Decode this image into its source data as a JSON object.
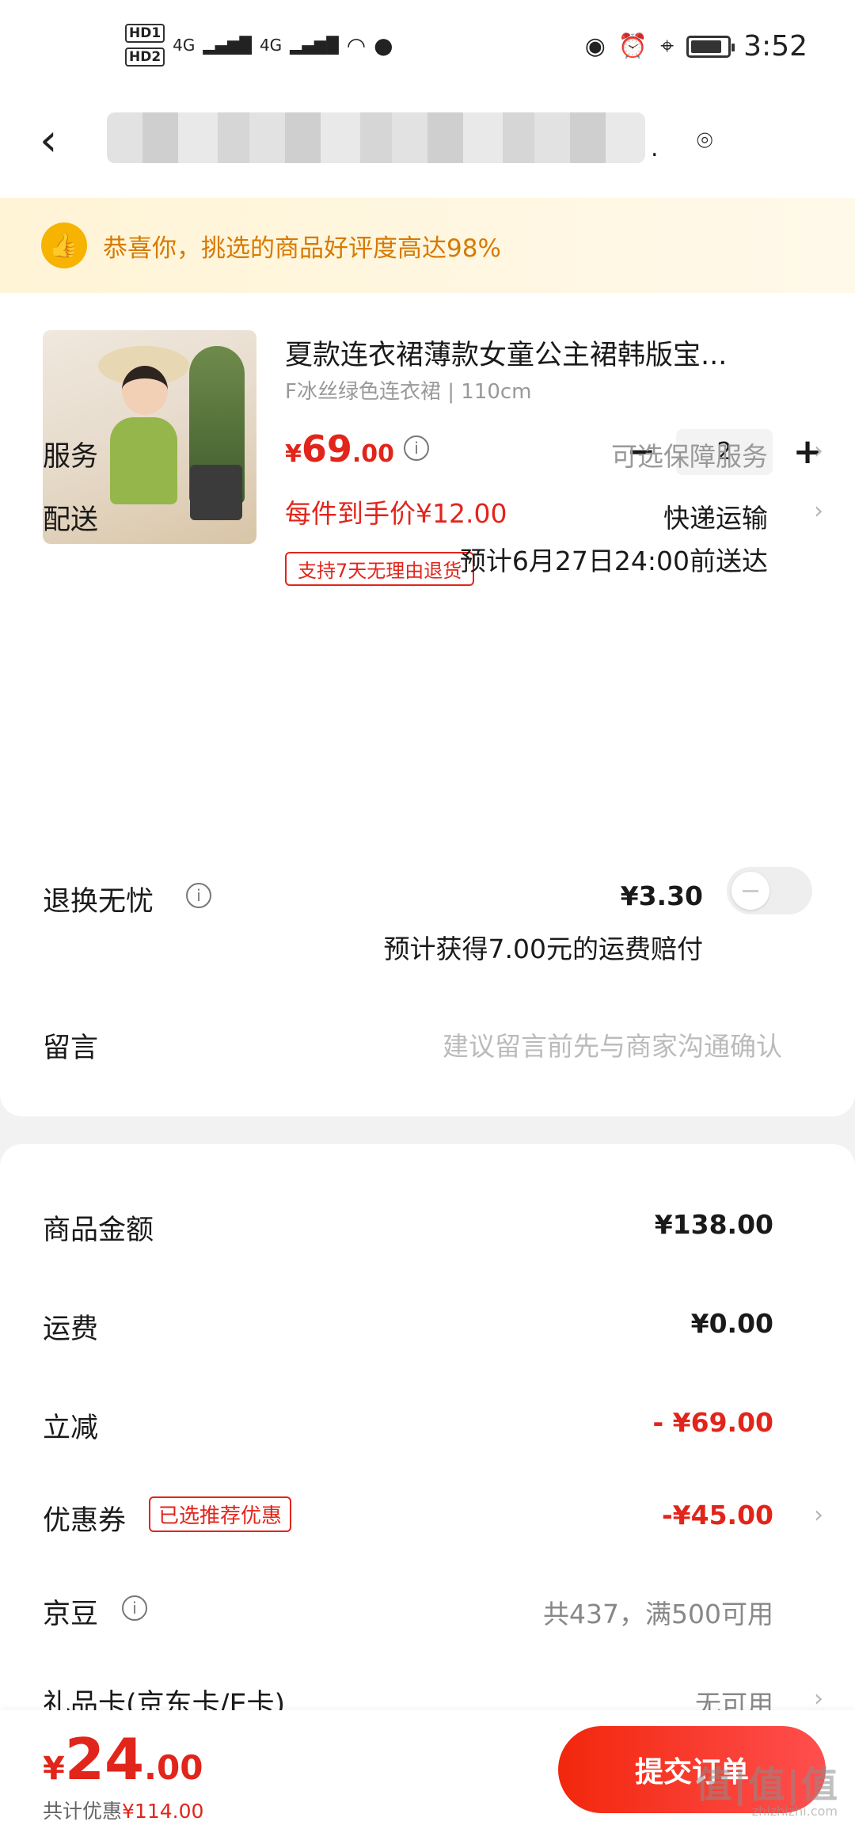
{
  "status_bar": {
    "hd1": "HD1",
    "hd2": "HD2",
    "net1": "4G",
    "net2": "4G",
    "time": "3:52"
  },
  "nav": {
    "back_icon": "chevron-left-icon",
    "address_blurred": "",
    "address_tail": ".",
    "location_icon": "location-pin-icon"
  },
  "banner": {
    "icon": "thumbs-up-icon",
    "text": "恭喜你，挑选的商品好评度高达98%"
  },
  "product": {
    "title": "夏款连衣裙薄款女童公主裙韩版宝...",
    "sku": "F冰丝绿色连衣裙 | 110cm",
    "price_symbol": "¥",
    "price_int": "69",
    "price_dec": ".00",
    "quantity": "2",
    "minus": "−",
    "plus": "+",
    "per_item_price": "每件到手价¥12.00",
    "return_tag": "支持7天无理由退货"
  },
  "rows": {
    "service_label": "服务",
    "service_value": "可选保障服务",
    "delivery_label": "配送",
    "delivery_value": "快递运输",
    "delivery_eta": "预计6月27日24:00前送达",
    "return_label": "退换无忧",
    "return_price": "¥3.30",
    "return_desc": "预计获得7.00元的运费赔付",
    "return_enabled": false,
    "message_label": "留言",
    "message_placeholder": "建议留言前先与商家沟通确认"
  },
  "summary": {
    "goods_label": "商品金额",
    "goods_value": "¥138.00",
    "shipping_label": "运费",
    "shipping_value": "¥0.00",
    "reduce_label": "立减",
    "reduce_value": "- ¥69.00",
    "coupon_label": "优惠券",
    "coupon_tag": "已选推荐优惠",
    "coupon_value": "-¥45.00",
    "jingdou_label": "京豆",
    "jingdou_value": "共437，满500可用",
    "giftcard_label": "礼品卡(京东卡/E卡)",
    "giftcard_value": "无可用"
  },
  "bottom": {
    "total_symbol": "¥",
    "total_int": "24",
    "total_dec": ".00",
    "discount_prefix": "共计优惠",
    "discount_value": "¥114.00",
    "submit": "提交订单",
    "watermark": "值|值|值",
    "watermark_sub": "zhizhizhi.com"
  },
  "colors": {
    "accent_red": "#e1251b",
    "banner_orange": "#d77a00"
  }
}
